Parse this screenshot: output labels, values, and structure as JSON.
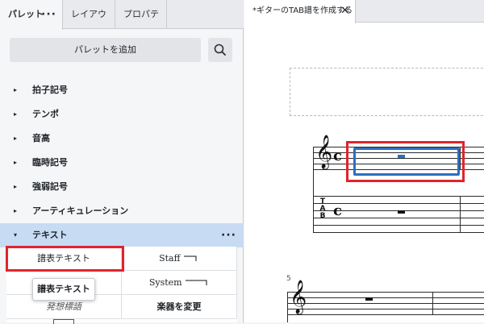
{
  "palette_tabs": [
    {
      "label": "パレット"
    },
    {
      "label": "レイアウト"
    },
    {
      "label": "プロパティ"
    }
  ],
  "palette_menu": "···",
  "add_palette_label": "パレットを追加",
  "categories": [
    {
      "label": "拍子記号",
      "arrow": "▸"
    },
    {
      "label": "テンポ",
      "arrow": "▸"
    },
    {
      "label": "音高",
      "arrow": "▸"
    },
    {
      "label": "臨時記号",
      "arrow": "▸"
    },
    {
      "label": "強弱記号",
      "arrow": "▸"
    },
    {
      "label": "アーティキュレーション",
      "arrow": "▸"
    },
    {
      "label": "テキスト",
      "arrow": "▾",
      "more": "···"
    }
  ],
  "text_palette": {
    "cells": [
      {
        "label": "譜表テキスト"
      },
      {
        "label": "Staff"
      },
      {
        "label": " "
      },
      {
        "label": "System"
      },
      {
        "label": "発想標語"
      },
      {
        "label": "楽器を変更"
      }
    ]
  },
  "tooltip": "譜表テキスト",
  "document_tab": {
    "title": "*ギターのTAB譜を作成する",
    "close": "✕"
  },
  "score": {
    "measure_number": "5",
    "tab_clef": [
      "T",
      "A",
      "B"
    ],
    "common_time": "c",
    "treble_clef": "𝄞"
  },
  "colors": {
    "highlight": "#e0242d",
    "selection": "#2c6fc0",
    "active_category": "#c7dcf3"
  }
}
